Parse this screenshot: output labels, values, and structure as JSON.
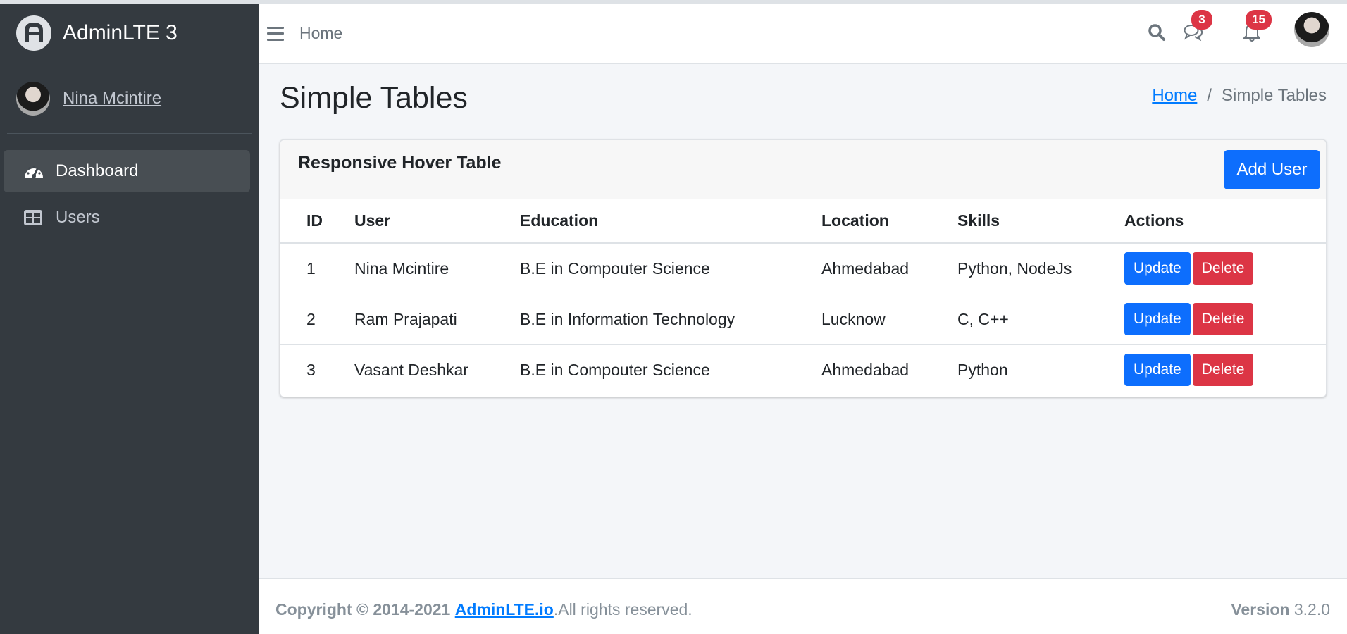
{
  "brand": {
    "title": "AdminLTE 3"
  },
  "user": {
    "name": "Nina Mcintire"
  },
  "sidebar": {
    "items": [
      {
        "label": "Dashboard",
        "icon": "tachometer-icon",
        "active": true
      },
      {
        "label": "Users",
        "icon": "table-icon",
        "active": false
      }
    ]
  },
  "header": {
    "home_link": "Home",
    "chat_badge": "3",
    "notification_badge": "15"
  },
  "page": {
    "title": "Simple Tables",
    "breadcrumb": {
      "home": "Home",
      "separator": "/",
      "current": "Simple Tables"
    }
  },
  "card": {
    "title": "Responsive Hover Table",
    "add_button": "Add User",
    "columns": [
      "ID",
      "User",
      "Education",
      "Location",
      "Skills",
      "Actions"
    ],
    "rows": [
      {
        "id": "1",
        "user": "Nina Mcintire",
        "education": "B.E in Compouter Science",
        "location": "Ahmedabad",
        "skills": "Python, NodeJs",
        "update": "Update",
        "delete": "Delete"
      },
      {
        "id": "2",
        "user": "Ram Prajapati",
        "education": "B.E in Information Technology",
        "location": "Lucknow",
        "skills": "C, C++",
        "update": "Update",
        "delete": "Delete"
      },
      {
        "id": "3",
        "user": "Vasant Deshkar",
        "education": "B.E in Compouter Science",
        "location": "Ahmedabad",
        "skills": "Python",
        "update": "Update",
        "delete": "Delete"
      }
    ]
  },
  "footer": {
    "copyright_prefix": "Copyright © 2014-2021",
    "link": "AdminLTE.io",
    "suffix": ".All rights reserved.",
    "version_label": "Version",
    "version": "3.2.0"
  },
  "colors": {
    "sidebar_bg": "#343a40",
    "primary": "#0d6efd",
    "danger": "#dc3545",
    "content_bg": "#f4f6f9"
  }
}
